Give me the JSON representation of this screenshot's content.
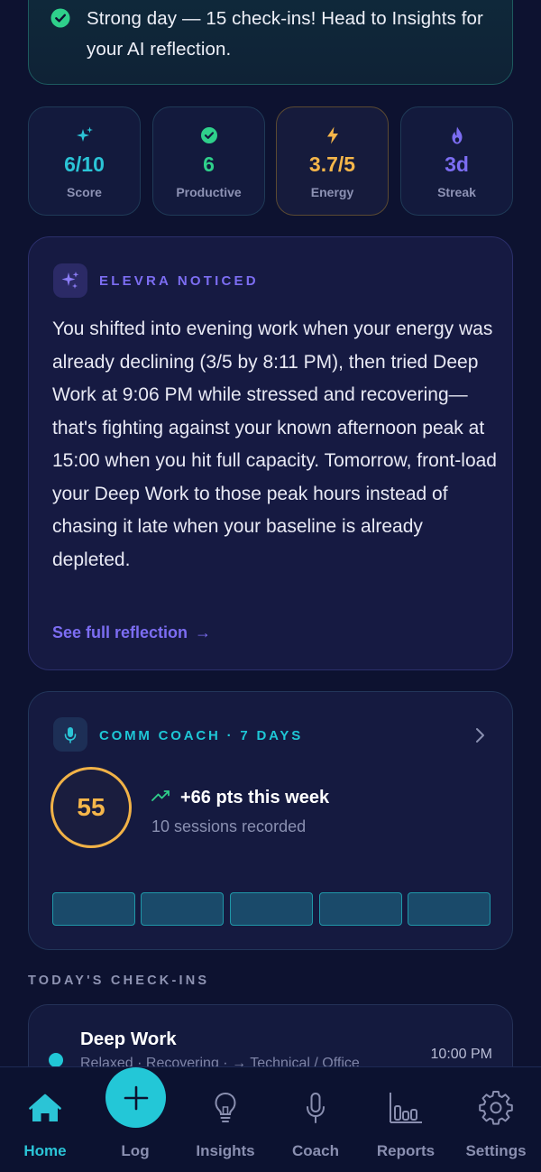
{
  "banner": {
    "text": "Strong day — 15 check-ins! Head to Insights for your AI reflection.",
    "icon": "check-circle-icon"
  },
  "stats": [
    {
      "value": "6/10",
      "label": "Score",
      "icon": "sparkles-icon",
      "color": "#2bc4d6"
    },
    {
      "value": "6",
      "label": "Productive",
      "icon": "check-circle-icon",
      "color": "#2fd08b"
    },
    {
      "value": "3.7/5",
      "label": "Energy",
      "icon": "bolt-icon",
      "color": "#f5b64a"
    },
    {
      "value": "3d",
      "label": "Streak",
      "icon": "flame-icon",
      "color": "#7c6df2"
    }
  ],
  "elevra": {
    "title": "ELEVRA NOTICED",
    "body": "You shifted into evening work when your energy was already declining (3/5 by 8:11 PM), then tried Deep Work at 9:06 PM while stressed and recovering—that's fighting against your known afternoon peak at 15:00 when you hit full capacity. Tomorrow, front-load your Deep Work to those peak hours instead of chasing it late when your baseline is already depleted.",
    "link": "See full reflection",
    "link_arrow": "→"
  },
  "coach": {
    "title": "COMM COACH · 7 DAYS",
    "score": "55",
    "trend": "+66 pts this week",
    "sessions": "10 sessions recorded",
    "bars": 5
  },
  "checkins": {
    "section_title": "TODAY'S CHECK-INS",
    "items": [
      {
        "title": "Deep Work",
        "subtitle": "Relaxed · Recovering · → Technical / Office",
        "time": "10:00 PM"
      }
    ]
  },
  "nav": [
    {
      "label": "Home",
      "icon": "home-icon",
      "active": true
    },
    {
      "label": "Log",
      "icon": "plus-icon"
    },
    {
      "label": "Insights",
      "icon": "lightbulb-icon"
    },
    {
      "label": "Coach",
      "icon": "microphone-icon"
    },
    {
      "label": "Reports",
      "icon": "bar-chart-icon"
    },
    {
      "label": "Settings",
      "icon": "gear-icon"
    }
  ],
  "colors": {
    "background": "#0d1230",
    "accent_teal": "#2bc4d6",
    "accent_purple": "#7c6df2",
    "accent_orange": "#f5b64a",
    "accent_green": "#2fd08b"
  }
}
